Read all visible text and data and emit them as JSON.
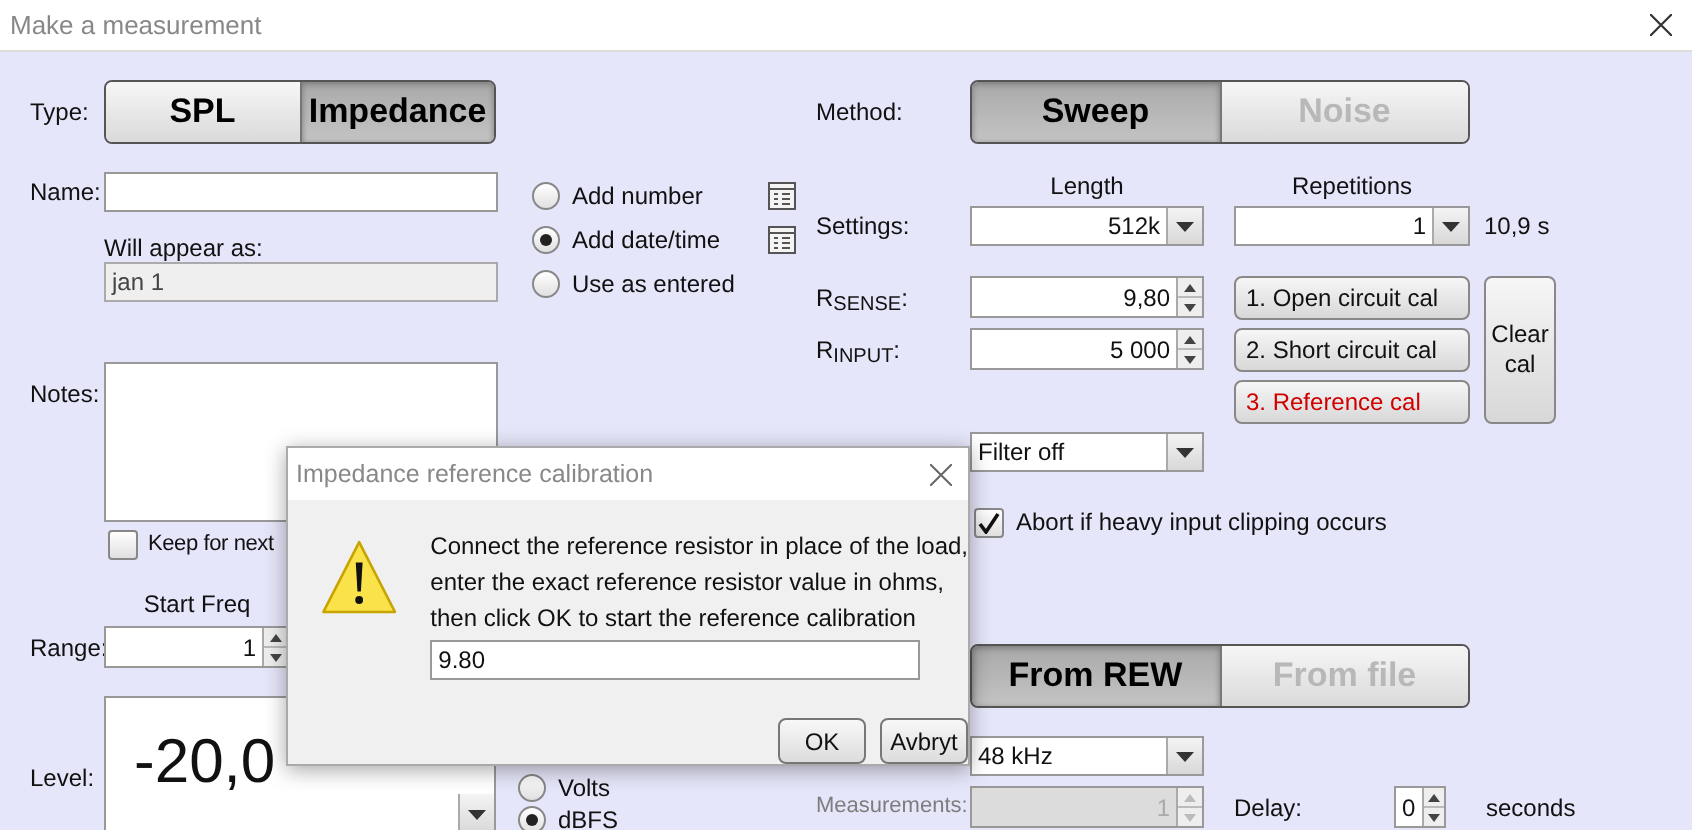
{
  "window": {
    "title": "Make a measurement"
  },
  "type": {
    "label": "Type:",
    "options": [
      {
        "label": "SPL",
        "selected": false,
        "disabled": false
      },
      {
        "label": "Impedance",
        "selected": true,
        "disabled": false
      }
    ]
  },
  "name": {
    "label": "Name:"
  },
  "naming_options": [
    {
      "label": "Add number",
      "selected": false,
      "has_settings": true
    },
    {
      "label": "Add date/time",
      "selected": true,
      "has_settings": true
    },
    {
      "label": "Use as entered",
      "selected": false,
      "has_settings": false
    }
  ],
  "will_appear_as": {
    "label": "Will appear as:",
    "value": "jan 1"
  },
  "notes": {
    "label": "Notes:"
  },
  "keep_for_next": {
    "label": "Keep for next",
    "checked": false
  },
  "range": {
    "label": "Range:",
    "start_freq": {
      "header": "Start Freq",
      "value": "1"
    }
  },
  "level": {
    "label": "Level:",
    "value": "-20,0",
    "units": [
      {
        "label": "Volts",
        "selected": false
      },
      {
        "label": "dBFS",
        "selected": true
      }
    ]
  },
  "method": {
    "label": "Method:",
    "options": [
      {
        "label": "Sweep",
        "selected": true,
        "disabled": false
      },
      {
        "label": "Noise",
        "selected": false,
        "disabled": true
      }
    ]
  },
  "settings": {
    "label": "Settings:",
    "length": {
      "header": "Length",
      "value": "512k"
    },
    "repetitions": {
      "header": "Repetitions",
      "value": "1"
    },
    "duration": "10,9 s"
  },
  "resistors": [
    {
      "label": "R$_{SENSE}$:",
      "value": "9,80"
    },
    {
      "label": "R$_{INPUT}$:",
      "value": "5 000"
    }
  ],
  "cal_buttons": [
    {
      "label": "1. Open circuit cal",
      "highlighted": false
    },
    {
      "label": "2. Short circuit cal",
      "highlighted": false
    },
    {
      "label": "3. Reference cal",
      "highlighted": true
    }
  ],
  "clear_cal": "Clear cal",
  "filter": {
    "value": "Filter off"
  },
  "abort_clipping": {
    "label": "Abort if heavy input clipping occurs",
    "checked": true
  },
  "source": {
    "options": [
      {
        "label": "From REW",
        "selected": true,
        "disabled": false
      },
      {
        "label": "From file",
        "selected": false,
        "disabled": true
      }
    ]
  },
  "sample_rate": {
    "value": "48 kHz"
  },
  "measurements": {
    "label": "Measurements:",
    "value": "1",
    "disabled": true
  },
  "delay": {
    "label": "Delay:",
    "value": "0",
    "unit": "seconds"
  },
  "dialog": {
    "title": "Impedance reference calibration",
    "message": [
      "Connect the reference resistor in place of the load,",
      "enter the exact reference resistor value in ohms,",
      "then click OK to start the reference calibration"
    ],
    "value": "9.80",
    "buttons": [
      "OK",
      "Avbryt"
    ]
  }
}
